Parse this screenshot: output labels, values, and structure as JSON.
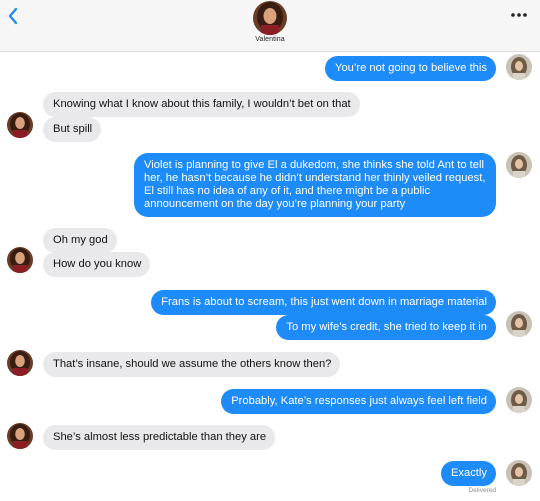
{
  "header": {
    "contact_name": "Valentina",
    "back_icon": "chevron-left-icon",
    "more_icon": "ellipsis-icon",
    "accent": "#1d8bf8"
  },
  "colors": {
    "outgoing": "#1d8bf8",
    "incoming": "#e9e9eb",
    "background": "#ffffff"
  },
  "messages": [
    {
      "side": "out",
      "text": "You’re not going to believe this"
    },
    {
      "side": "in",
      "text": "Knowing what I know about this family, I wouldn’t bet on that"
    },
    {
      "side": "in",
      "text": "But spill"
    },
    {
      "side": "out",
      "text": "Violet is planning to give El a dukedom, she thinks she told Ant to tell her, he hasn’t because he didn’t understand her thinly veiled request, El still has no idea of any of it, and there might be a public announcement on the day you’re planning your party"
    },
    {
      "side": "in",
      "text": "Oh my god"
    },
    {
      "side": "in",
      "text": "How do you know"
    },
    {
      "side": "out",
      "text": "Frans is about to scream, this just went down in marriage material"
    },
    {
      "side": "out",
      "text": "To my wife’s credit, she tried to keep it in"
    },
    {
      "side": "in",
      "text": "That’s insane, should we assume the others know then?"
    },
    {
      "side": "out",
      "text": "Probably, Kate’s responses just always feel left field"
    },
    {
      "side": "in",
      "text": "She’s almost less predictable than they are"
    },
    {
      "side": "out",
      "text": "Exactly"
    }
  ],
  "status": "Delivered"
}
